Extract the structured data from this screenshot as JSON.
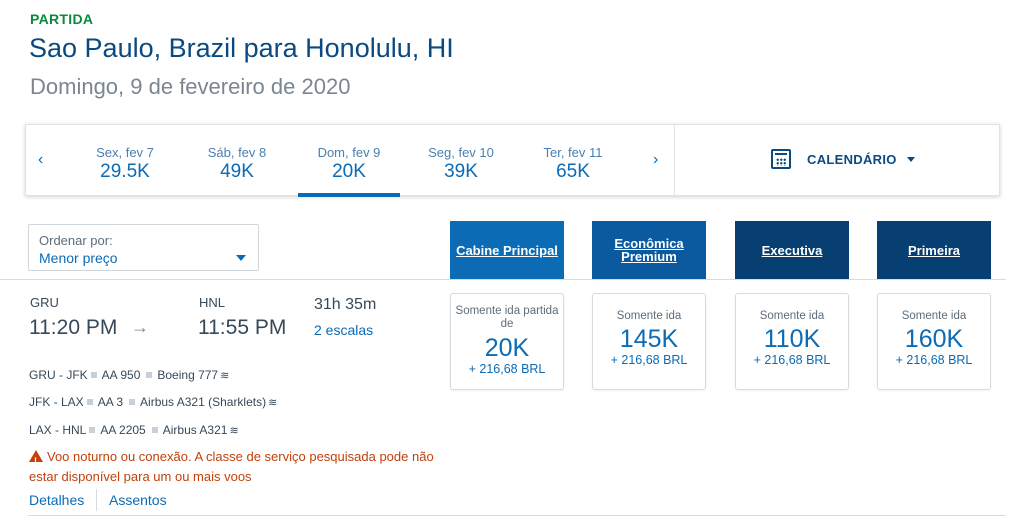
{
  "header": {
    "section_label": "PARTIDA",
    "route": "Sao Paulo, Brazil para Honolulu, HI",
    "date": "Domingo, 9 de fevereiro de 2020"
  },
  "date_bar": {
    "prev_arrow": "‹",
    "next_arrow": "›",
    "days": [
      {
        "label": "Sex, fev 7",
        "price": "29.5K"
      },
      {
        "label": "Sáb, fev 8",
        "price": "49K"
      },
      {
        "label": "Dom, fev 9",
        "price": "20K"
      },
      {
        "label": "Seg, fev 10",
        "price": "39K"
      },
      {
        "label": "Ter, fev 11",
        "price": "65K"
      }
    ],
    "selected_index": 2,
    "calendar_label": "CALENDÁRIO",
    "calendar_icon": "calendar-icon"
  },
  "sort": {
    "label": "Ordenar por:",
    "value": "Menor preço"
  },
  "cabins": [
    {
      "label": "Cabine Principal",
      "color": "#0b6bb5"
    },
    {
      "label": "Econômica Premium",
      "color": "#0b5aa0"
    },
    {
      "label": "Executiva",
      "color": "#073f72"
    },
    {
      "label": "Primeira",
      "color": "#073f72"
    }
  ],
  "flight": {
    "origin_code": "GRU",
    "origin_time": "11:20 PM",
    "arrow": "→",
    "dest_code": "HNL",
    "dest_time": "11:55 PM",
    "duration": "31h 35m",
    "stops": "2 escalas",
    "segments": [
      {
        "route": "GRU - JFK",
        "flight": "AA 950",
        "aircraft": "Boeing 777"
      },
      {
        "route": "JFK - LAX",
        "flight": "AA 3",
        "aircraft": "Airbus A321 (Sharklets)"
      },
      {
        "route": "LAX - HNL",
        "flight": "AA 2205",
        "aircraft": "Airbus A321"
      }
    ],
    "warning": "Voo noturno ou conexão. A classe de serviço pesquisada pode não estar disponível para um ou mais voos",
    "details_link": "Detalhes",
    "seats_link": "Assentos"
  },
  "fares": [
    {
      "note_line1": "Somente ida partida",
      "note_line2": "de",
      "miles": "20K",
      "fee": "+ 216,68 BRL"
    },
    {
      "note_line1": "Somente ida",
      "note_line2": "",
      "miles": "145K",
      "fee": "+ 216,68 BRL"
    },
    {
      "note_line1": "Somente ida",
      "note_line2": "",
      "miles": "110K",
      "fee": "+ 216,68 BRL"
    },
    {
      "note_line1": "Somente ida",
      "note_line2": "",
      "miles": "160K",
      "fee": "+ 216,68 BRL"
    }
  ]
}
